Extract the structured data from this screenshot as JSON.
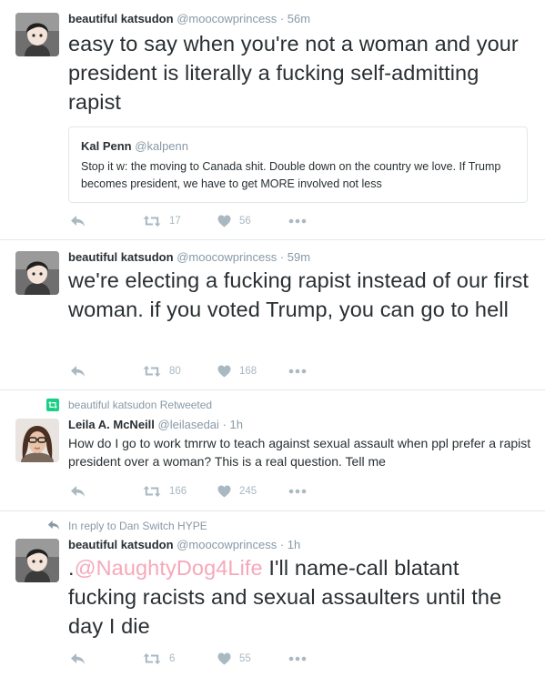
{
  "colors": {
    "text": "#292f33",
    "muted": "#8899a6",
    "icon": "#aab8c2",
    "border": "#e1e8ed",
    "mention": "#f7a8b8",
    "retweet_green": "#19cf86"
  },
  "tweets": [
    {
      "author_name": "beautiful katsudon",
      "author_handle": "@moocowprincess",
      "separator": "·",
      "time": "56m",
      "text": "easy to say when you're not a woman and your president is literally a fucking self-admitting rapist",
      "quote": {
        "author_name": "Kal Penn",
        "author_handle": "@kalpenn",
        "text": "Stop it w: the moving to Canada shit. Double down on the country we love. If Trump becomes president, we have to get MORE involved not less"
      },
      "retweets": "17",
      "likes": "56"
    },
    {
      "author_name": "beautiful katsudon",
      "author_handle": "@moocowprincess",
      "separator": "·",
      "time": "59m",
      "text": "we're electing a fucking rapist instead of our first woman. if you voted Trump, you can go to hell",
      "retweets": "80",
      "likes": "168"
    },
    {
      "context": "beautiful katsudon Retweeted",
      "author_name": "Leila A. McNeill",
      "author_handle": "@leilasedai",
      "separator": "·",
      "time": "1h",
      "text": "How do I go to work tmrrw to teach against sexual assault when ppl prefer a rapist president over a woman? This is a real question. Tell me",
      "retweets": "166",
      "likes": "245"
    },
    {
      "context": "In reply to Dan Switch HYPE",
      "author_name": "beautiful katsudon",
      "author_handle": "@moocowprincess",
      "separator": "·",
      "time": "1h",
      "text_prefix": ".",
      "mention": "@NaughtyDog4Life",
      "text": " I'll name-call blatant fucking racists and sexual assaulters until the day I die",
      "retweets": "6",
      "likes": "55"
    }
  ]
}
